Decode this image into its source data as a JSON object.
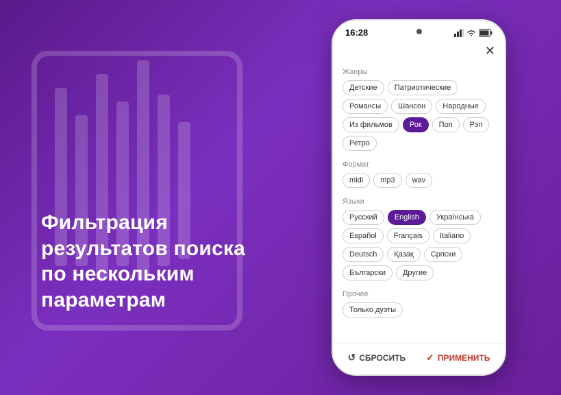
{
  "background": {
    "gradient_start": "#5a1a8a",
    "gradient_end": "#6a1f9a"
  },
  "left": {
    "title": "Фильтрация результатов поиска по нескольким параметрам"
  },
  "phone": {
    "time": "16:28",
    "close_label": "✕",
    "sections": [
      {
        "id": "genres",
        "label": "Жанры",
        "tags": [
          {
            "label": "Детские",
            "active": false
          },
          {
            "label": "Патриотические",
            "active": false
          },
          {
            "label": "Романсы",
            "active": false
          },
          {
            "label": "Шансон",
            "active": false
          },
          {
            "label": "Народные",
            "active": false
          },
          {
            "label": "Из фильмов",
            "active": false
          },
          {
            "label": "Рок",
            "active": true
          },
          {
            "label": "Поп",
            "active": false
          },
          {
            "label": "Рэп",
            "active": false
          },
          {
            "label": "Ретро",
            "active": false
          }
        ]
      },
      {
        "id": "format",
        "label": "Формат",
        "tags": [
          {
            "label": "midi",
            "active": false
          },
          {
            "label": "mp3",
            "active": false
          },
          {
            "label": "wav",
            "active": false
          }
        ]
      },
      {
        "id": "languages",
        "label": "Языки",
        "tags": [
          {
            "label": "Русский",
            "active": false
          },
          {
            "label": "English",
            "active": true
          },
          {
            "label": "Українська",
            "active": false
          },
          {
            "label": "Español",
            "active": false
          },
          {
            "label": "Français",
            "active": false
          },
          {
            "label": "Italiano",
            "active": false
          },
          {
            "label": "Deutsch",
            "active": false
          },
          {
            "label": "Қазақ",
            "active": false
          },
          {
            "label": "Српски",
            "active": false
          },
          {
            "label": "Български",
            "active": false
          },
          {
            "label": "Другие",
            "active": false
          }
        ]
      },
      {
        "id": "other",
        "label": "Прочее",
        "tags": [
          {
            "label": "Только дуэты",
            "active": false
          }
        ]
      }
    ],
    "bottom": {
      "reset_label": "СБРОСИТЬ",
      "apply_label": "ПРИМЕНИТЬ"
    }
  }
}
